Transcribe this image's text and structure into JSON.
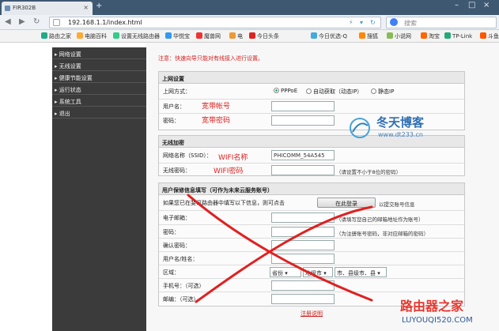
{
  "browser": {
    "tab_title": "FIR302B",
    "url": "192.168.1.1/index.html",
    "search_placeholder": "搜索",
    "bookmarks": [
      "路由之家",
      "电脑百科",
      "设置无线路由器",
      "华悦宝",
      "魔兽网",
      "电",
      "今日头条",
      "今日优选-Q",
      "搜狐",
      "小说网",
      "淘宝",
      "TP-Link",
      "斗鱼"
    ]
  },
  "sidebar": {
    "items": [
      "网络设置",
      "无线设置",
      "健康节能设置",
      "运行状态",
      "系统工具",
      "退出"
    ]
  },
  "notice": "注意：快速向导只能对有线接入进行设置。",
  "internet": {
    "title": "上网设置",
    "mode_label": "上网方式：",
    "modes": [
      "PPPoE",
      "自动获取（动态IP）",
      "静态IP"
    ],
    "username_label": "用户名：",
    "password_label": "密码：",
    "ann_account": "宽带帐号",
    "ann_password": "宽带密码"
  },
  "wireless": {
    "title": "无线加密",
    "ssid_label": "网络名称（SSID）：",
    "ssid_value": "PHICOMM_54A545",
    "key_label": "无线密码：",
    "key_hint": "（请设置不小于8位的密码）",
    "ann_name": "WIFI名称",
    "ann_password": "WIFI密码"
  },
  "user": {
    "title": "用户保修信息填写（可作为未来云服务账号）",
    "intro": "如果您已在斐讯路由器中填写以下信息，则可点击",
    "login_button": "在此登录",
    "intro_tail": "以提交账号信息",
    "email_label": "电子邮箱：",
    "email_hint": "（请填写您自己的邮箱地址作为账号）",
    "password_label": "密码：",
    "password_hint": "（为注册账号密码，非对应邮箱的密码）",
    "confirm_label": "确认密码：",
    "name_label": "用户名/姓名：",
    "region_label": "区域：",
    "province": "省份",
    "city": "地级市",
    "county": "市、县级市、县",
    "phone_label": "手机号：（可选）",
    "postcode_label": "邮编：（可选）",
    "register_link": "注册说明"
  },
  "watermarks": {
    "blog_name": "冬天博客",
    "blog_url": "www.dt233.cn",
    "site_name": "路由器之家",
    "site_url": "LUYOUQI520.COM"
  },
  "colors": {
    "annotation_red": "#e02020",
    "menu_bg": "#3b3b3b",
    "tabbar_bg": "#3f5872"
  }
}
